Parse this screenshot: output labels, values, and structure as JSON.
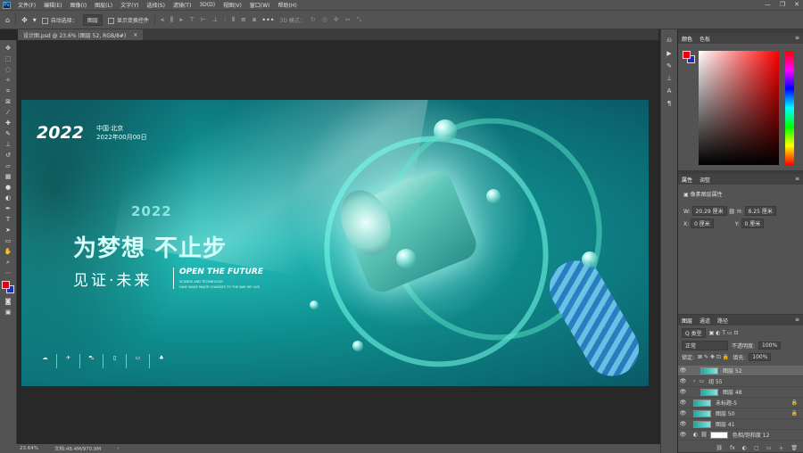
{
  "app": {
    "logo": "Ps",
    "menu": [
      "文件(F)",
      "编辑(E)",
      "图像(I)",
      "图层(L)",
      "文字(Y)",
      "选择(S)",
      "滤镜(T)",
      "3D(D)",
      "视图(V)",
      "窗口(W)",
      "帮助(H)"
    ],
    "window_controls": [
      "—",
      "❐",
      "✕"
    ]
  },
  "options": {
    "auto_select_label": "自动选择：",
    "auto_select_target": "图层",
    "show_transform_label": "显示变换控件",
    "mode_3d_label": "3D 模式：",
    "more": "•••"
  },
  "document": {
    "tab_title": "设计图.psd @ 23.6% (图层 52, RGB/8#)",
    "tab_close": "×"
  },
  "artboard": {
    "year": "2022",
    "location": "中国·北京",
    "date": "2022年00月00日",
    "year_outline": "2022",
    "headline": "为梦想 不止步",
    "subheadline": "见证·未来",
    "slogan": "OPEN THE FUTURE",
    "tagline1": "SCIENCE AND TECHNOLOGY",
    "tagline2": "HAVE MADE MAJOR CHANGES TO THE WAY WE LIVE"
  },
  "panels": {
    "color": {
      "tab_active": "颜色",
      "tab2": "色板",
      "fg_color": "#e60012",
      "bg_color": "#1d2dbf"
    },
    "properties": {
      "tab_active": "属性",
      "tab2": "调整",
      "section": "像素图层属性",
      "w_label": "W:",
      "w_value": "20.29 厘米",
      "h_label": "H:",
      "h_value": "8.25 厘米",
      "x_label": "X:",
      "x_value": "0 厘米",
      "y_label": "Y:",
      "y_value": "0 厘米"
    },
    "layers": {
      "tab_active": "图层",
      "tab2": "通道",
      "tab3": "路径",
      "filter": "Q 类型",
      "blend_mode": "正常",
      "opacity_label": "不透明度:",
      "opacity_value": "100%",
      "lock_label": "锁定:",
      "fill_label": "填充:",
      "fill_value": "100%",
      "items": [
        {
          "name": "图层 52",
          "selected": true,
          "locked": false
        },
        {
          "name": "组 55",
          "selected": false,
          "locked": false
        },
        {
          "name": "图层 48",
          "selected": false,
          "locked": false
        },
        {
          "name": "未标题-5",
          "selected": false,
          "locked": true
        },
        {
          "name": "图层 50",
          "selected": false,
          "locked": true
        },
        {
          "name": "图层 41",
          "selected": false,
          "locked": false
        },
        {
          "name": "色相/饱和度 12",
          "selected": false,
          "locked": false
        }
      ],
      "bottom_icons": [
        "fx",
        "◐",
        "▢",
        "▭",
        "＋",
        "🗑"
      ]
    }
  },
  "status": {
    "zoom": "23.64%",
    "doc_info": "文档:48.4M/970.9M"
  }
}
